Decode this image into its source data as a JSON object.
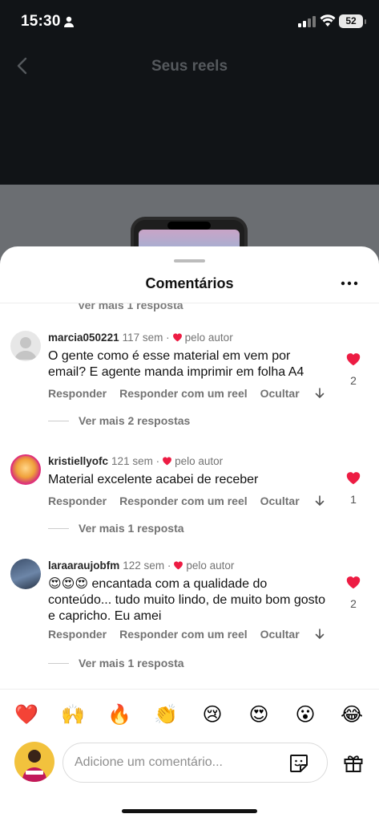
{
  "status_bar": {
    "time": "15:30",
    "battery": "52"
  },
  "header": {
    "title": "Seus reels"
  },
  "sheet": {
    "title": "Comentários"
  },
  "ghost_more": "Ver mais 1 resposta",
  "comments": [
    {
      "user": "marcia050221",
      "time": "117 sem",
      "sep": "·",
      "liked_label": "pelo autor",
      "text": "O gente como é esse material em vem por email? E agente manda imprimir em folha A4",
      "reply": "Responder",
      "reply_reel": "Responder com um reel",
      "hide": "Ocultar",
      "likes": "2",
      "more_replies": "Ver mais 2 respostas"
    },
    {
      "user": "kristiellyofc",
      "time": "121 sem",
      "sep": "·",
      "liked_label": "pelo autor",
      "text": "Material excelente acabei de receber",
      "reply": "Responder",
      "reply_reel": "Responder com um reel",
      "hide": "Ocultar",
      "likes": "1",
      "more_replies": "Ver mais 1 resposta"
    },
    {
      "user": "laraaraujobfm",
      "time": "122 sem",
      "sep": "·",
      "liked_label": "pelo autor",
      "text": "😍😍😍 encantada com a qualidade do conteúdo... tudo muito lindo, de muito bom gosto e capricho. Eu amei",
      "reply": "Responder",
      "reply_reel": "Responder com um reel",
      "hide": "Ocultar",
      "likes": "2",
      "more_replies": "Ver mais 1 resposta"
    }
  ],
  "quick_emojis": [
    "❤️",
    "🙌",
    "🔥",
    "👏",
    "😢",
    "😍",
    "😮",
    "😂"
  ],
  "composer": {
    "placeholder": "Adicione um comentário..."
  },
  "colors": {
    "accent_red": "#ed1c43",
    "sheet_bg": "#ffffff",
    "dim_bg": "#111417"
  }
}
